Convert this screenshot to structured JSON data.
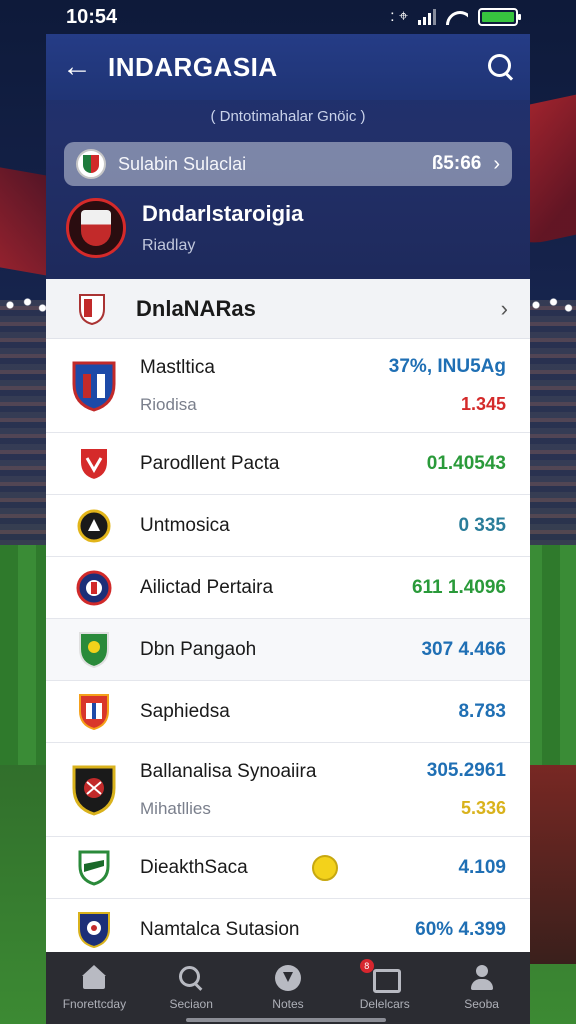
{
  "status_bar": {
    "time": "10:54",
    "extra_icon": ": ⌖"
  },
  "header": {
    "title": "INDARGASIA",
    "subtitle": "( Dntotimahalar Gnöic )",
    "match": {
      "name": "Sulabin Sulaclai",
      "score": "ß5:66"
    },
    "featured": {
      "title": "Dndarlstaroigia",
      "subtitle": "Riadlay"
    }
  },
  "section": {
    "title": "DnlaNARas"
  },
  "rows": [
    {
      "name": "Mastltica",
      "sub": "Riodisa",
      "value": "37%, INU5Ag",
      "value_color": "#1f6fb4",
      "value2": "1.345",
      "value2_color": "#d42a2a",
      "crest": "blue-red-shield"
    },
    {
      "name": "Parodllent Pacta",
      "value": "01.40543",
      "value_color": "#2a9a3a",
      "crest": "red-shield"
    },
    {
      "name": "Untmosica",
      "value": "0 335",
      "value_color": "#2a7d9a",
      "crest": "black-yellow-round"
    },
    {
      "name": "Ailictad Pertaira",
      "value": "611 1.4096",
      "value_color": "#2a9a3a",
      "crest": "navy-red-round"
    },
    {
      "name": "Dbn Pangaoh",
      "value": "307 4.466",
      "value_color": "#1f6fb4",
      "crest": "green-shield"
    },
    {
      "name": "Saphiedsa",
      "value": "8.783",
      "value_color": "#1f6fb4",
      "crest": "red-white-shield"
    },
    {
      "name": "Ballanalisa Synoaiira",
      "sub": "Mihatllies",
      "value": "305.2961",
      "value_color": "#1f6fb4",
      "value2": "5.336",
      "value2_color": "#d9b21c",
      "crest": "black-gold-shield"
    },
    {
      "name": "DieakthSaca",
      "value": "4.109",
      "value_color": "#1f6fb4",
      "crest": "green-white-shield"
    },
    {
      "name": "Namtalca Sutasion",
      "value": "60% 4.399",
      "value_color": "#1f6fb4",
      "crest": "navy-gold-shield"
    }
  ],
  "bottom_nav": [
    {
      "label": "Fnorettcday",
      "icon": "home-icon"
    },
    {
      "label": "Seciaon",
      "icon": "search-icon"
    },
    {
      "label": "Notes",
      "icon": "notes-icon"
    },
    {
      "label": "Delelcars",
      "icon": "inbox-icon",
      "badge": "8"
    },
    {
      "label": "Seoba",
      "icon": "profile-icon"
    }
  ]
}
